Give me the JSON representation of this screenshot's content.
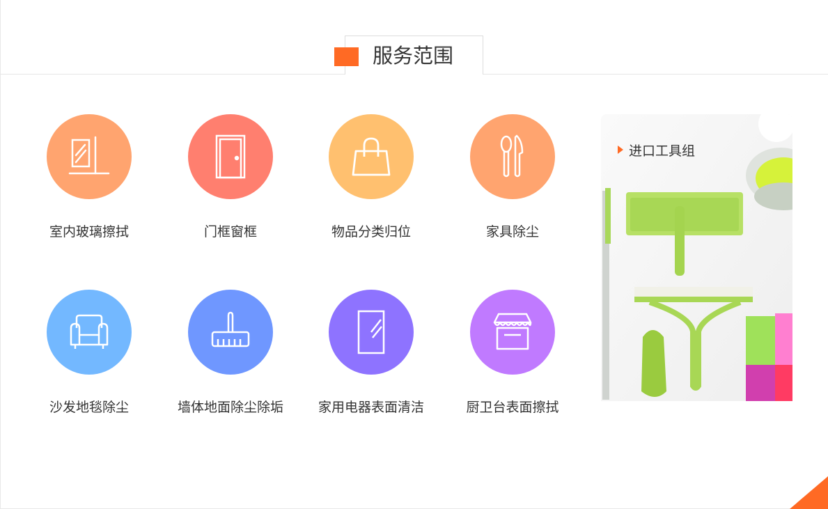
{
  "section": {
    "title": "服务范围"
  },
  "services": [
    {
      "label": "室内玻璃擦拭",
      "color": "#ffa46f",
      "icon": "glass-wipe-icon"
    },
    {
      "label": "门框窗框",
      "color": "#ff7f6f",
      "icon": "door-icon"
    },
    {
      "label": "物品分类归位",
      "color": "#ffc06f",
      "icon": "shopping-bag-icon"
    },
    {
      "label": "家具除尘",
      "color": "#ffa46f",
      "icon": "utensils-icon"
    },
    {
      "label": "沙发地毯除尘",
      "color": "#73b8ff",
      "icon": "sofa-icon"
    },
    {
      "label": "墙体地面除尘除垢",
      "color": "#6f97ff",
      "icon": "broom-icon"
    },
    {
      "label": "家用电器表面清洁",
      "color": "#8e73ff",
      "icon": "mirror-icon"
    },
    {
      "label": "厨卫台表面擦拭",
      "color": "#c07aff",
      "icon": "storefront-icon"
    }
  ],
  "promo": {
    "label": "进口工具组"
  },
  "colors": {
    "accent": "#ff6a24"
  }
}
